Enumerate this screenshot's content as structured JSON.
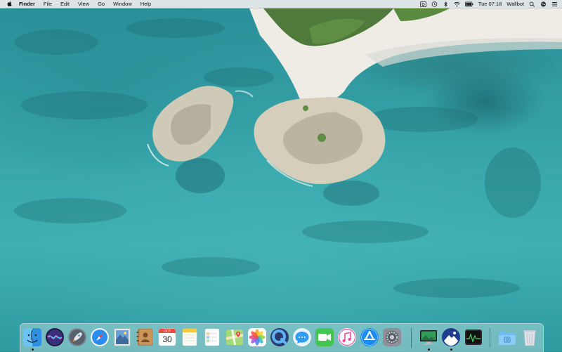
{
  "menubar": {
    "app_name": "Finder",
    "menus": [
      "File",
      "Edit",
      "View",
      "Go",
      "Window",
      "Help"
    ],
    "status": {
      "clock": "Tue 07:18",
      "user": "Wallbot"
    }
  },
  "dock": {
    "calendar": {
      "month": "OCT",
      "day": "30"
    },
    "items": [
      {
        "name": "finder-icon"
      },
      {
        "name": "siri-icon"
      },
      {
        "name": "launchpad-icon"
      },
      {
        "name": "safari-icon"
      },
      {
        "name": "mail-icon"
      },
      {
        "name": "contacts-icon"
      },
      {
        "name": "calendar-icon"
      },
      {
        "name": "notes-icon"
      },
      {
        "name": "reminders-icon"
      },
      {
        "name": "maps-icon"
      },
      {
        "name": "photos-icon"
      },
      {
        "name": "quicktime-icon"
      },
      {
        "name": "messages-icon"
      },
      {
        "name": "facetime-icon"
      },
      {
        "name": "itunes-icon"
      },
      {
        "name": "app-store-icon"
      },
      {
        "name": "system-preferences-icon"
      },
      {
        "name": "desktop-app-icon"
      },
      {
        "name": "wallpaper-app-icon"
      },
      {
        "name": "activity-monitor-icon"
      },
      {
        "name": "downloads-folder-icon"
      },
      {
        "name": "trash-icon"
      }
    ]
  },
  "colors": {
    "menubar_bg": "#ececec",
    "sea_primary": "#36a3a8",
    "sand": "#efece4"
  }
}
